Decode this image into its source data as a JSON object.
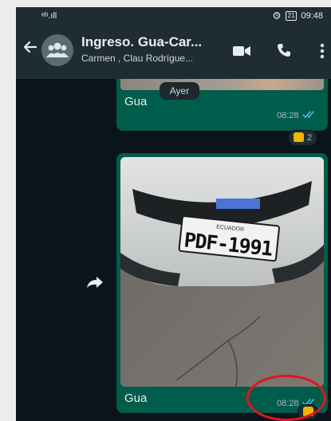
{
  "status_bar": {
    "signal": "ᵉᵇ.ıll",
    "time": "09:48",
    "battery": "21"
  },
  "header": {
    "title": "Ingreso. Gua-Car...",
    "subtitle": "Carmen , Clau Rodrígue..."
  },
  "day_chip": "Ayer",
  "messages": [
    {
      "caption": "Gua",
      "time": "08:28",
      "reaction_count": "2"
    },
    {
      "caption": "Gua",
      "time": "08:28",
      "plate_country": "ECUADOR",
      "plate_number": "PDF-1991"
    }
  ],
  "colors": {
    "header_bg": "#1f2c34",
    "chat_bg": "#0b141a",
    "outgoing_bubble": "#005c4b",
    "read_ticks": "#53bdeb",
    "highlight_circle": "#e0161b"
  },
  "icons": [
    "back-arrow-icon",
    "group-avatar-icon",
    "video-call-icon",
    "phone-icon",
    "more-options-icon",
    "double-check-icon",
    "thumbs-up-icon",
    "forward-icon"
  ]
}
